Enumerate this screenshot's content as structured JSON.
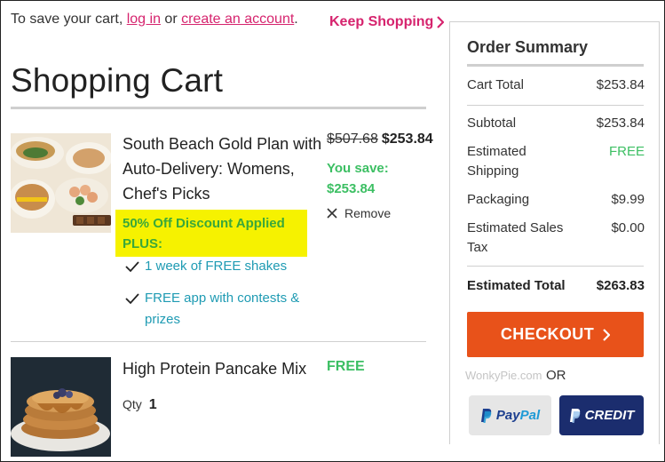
{
  "login_prompt": {
    "prefix": "To save your cart, ",
    "login_link": "log in",
    "middle": " or ",
    "create_link": "create an account",
    "suffix": "."
  },
  "keep_shopping": "Keep Shopping",
  "page_title": "Shopping Cart",
  "items": [
    {
      "name": "South Beach Gold Plan with Auto-Delivery: Womens, Chef's Picks",
      "discount_line1": "50% Off Discount Applied",
      "discount_line2": "PLUS:",
      "perks": [
        "1 week of FREE shakes",
        "FREE app with contests & prizes"
      ],
      "original_price": "$507.68",
      "price": "$253.84",
      "you_save_label": "You save:",
      "you_save_amount": "$253.84",
      "remove_label": "Remove",
      "image_icon": "meal-plate-photo"
    },
    {
      "name": "High Protein Pancake Mix",
      "price": "FREE",
      "qty_label": "Qty",
      "qty_value": "1",
      "image_icon": "pancake-stack-photo"
    }
  ],
  "summary": {
    "title": "Order Summary",
    "rows": [
      {
        "label": "Cart Total",
        "value": "$253.84"
      },
      {
        "label": "Subtotal",
        "value": "$253.84"
      },
      {
        "label": "Estimated Shipping",
        "value": "FREE"
      },
      {
        "label": "Packaging",
        "value": "$9.99"
      },
      {
        "label": "Estimated Sales Tax",
        "value": "$0.00"
      },
      {
        "label": "Estimated Total",
        "value": "$263.83"
      }
    ],
    "checkout_label": "CHECKOUT",
    "watermark": "WonkyPie.com",
    "or_label": "OR",
    "paypal_label": "PayPal",
    "paypal_prefix": "Pay",
    "paypal_suffix": "Pal",
    "credit_label": "CREDIT"
  },
  "colors": {
    "accent_pink": "#d6246e",
    "save_green": "#3cbf63",
    "checkout_orange": "#e8521a",
    "link_teal": "#1f9bb3",
    "highlight_yellow": "#f6f200",
    "paypal_navy": "#1b2d6e"
  }
}
